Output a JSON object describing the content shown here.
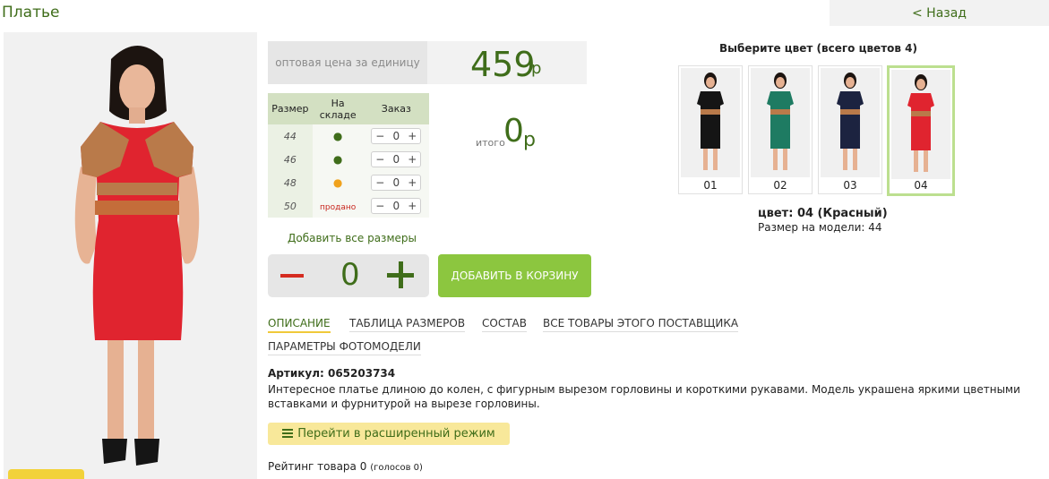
{
  "header": {
    "title": "Платье",
    "back_label": "< Назад"
  },
  "price": {
    "label": "оптовая цена за единицу",
    "value": "459",
    "currency": "р"
  },
  "sizes_table": {
    "headers": [
      "Размер",
      "На складе",
      "Заказ"
    ],
    "rows": [
      {
        "size": "44",
        "stock": "●",
        "stock_status": "in-stock",
        "qty": "0"
      },
      {
        "size": "46",
        "stock": "●",
        "stock_status": "in-stock",
        "qty": "0"
      },
      {
        "size": "48",
        "stock": "●",
        "stock_status": "low-stock",
        "qty": "0"
      },
      {
        "size": "50",
        "stock": "продано",
        "stock_status": "sold",
        "qty": "0"
      }
    ],
    "minus": "−",
    "plus": "+"
  },
  "total": {
    "label": "итого",
    "value": "0",
    "currency": "р"
  },
  "add_all_label": "Добавить все размеры",
  "quantity": {
    "value": "0"
  },
  "cart_button_label": "ДОБАВИТЬ В КОРЗИНУ",
  "tabs": [
    {
      "label": "ОПИСАНИЕ",
      "active": true
    },
    {
      "label": "ТАБЛИЦА РАЗМЕРОВ",
      "active": false
    },
    {
      "label": "СОСТАВ",
      "active": false
    },
    {
      "label": "ВСЕ ТОВАРЫ ЭТОГО ПОСТАВЩИКА",
      "active": false
    },
    {
      "label": "ПАРАМЕТРЫ ФОТОМОДЕЛИ",
      "active": false
    }
  ],
  "article": "Артикул: 065203734",
  "description": "Интересное платье длиною до колен, с фигурным вырезом горловины и короткими рукавами. Модель украшена яркими цветными вставками и фурнитурой на вырезе горловины.",
  "advanced_mode_label": "Перейти в расширенный режим",
  "rating": {
    "label": "Рейтинг товара 0",
    "votes": "(голосов 0)"
  },
  "colors": {
    "heading": "Выберите цвет (всего цветов 4)",
    "options": [
      {
        "num": "01",
        "dress_color": "#151515"
      },
      {
        "num": "02",
        "dress_color": "#1e7b62"
      },
      {
        "num": "03",
        "dress_color": "#1c2340"
      },
      {
        "num": "04",
        "dress_color": "#e0242f"
      }
    ],
    "selected": "цвет: 04 (Красный)",
    "model_size": "Размер на модели: 44"
  },
  "theme": {
    "accent_green": "#3f6d1a",
    "button_green": "#8cc63f",
    "dress_red": "#e0242f"
  }
}
